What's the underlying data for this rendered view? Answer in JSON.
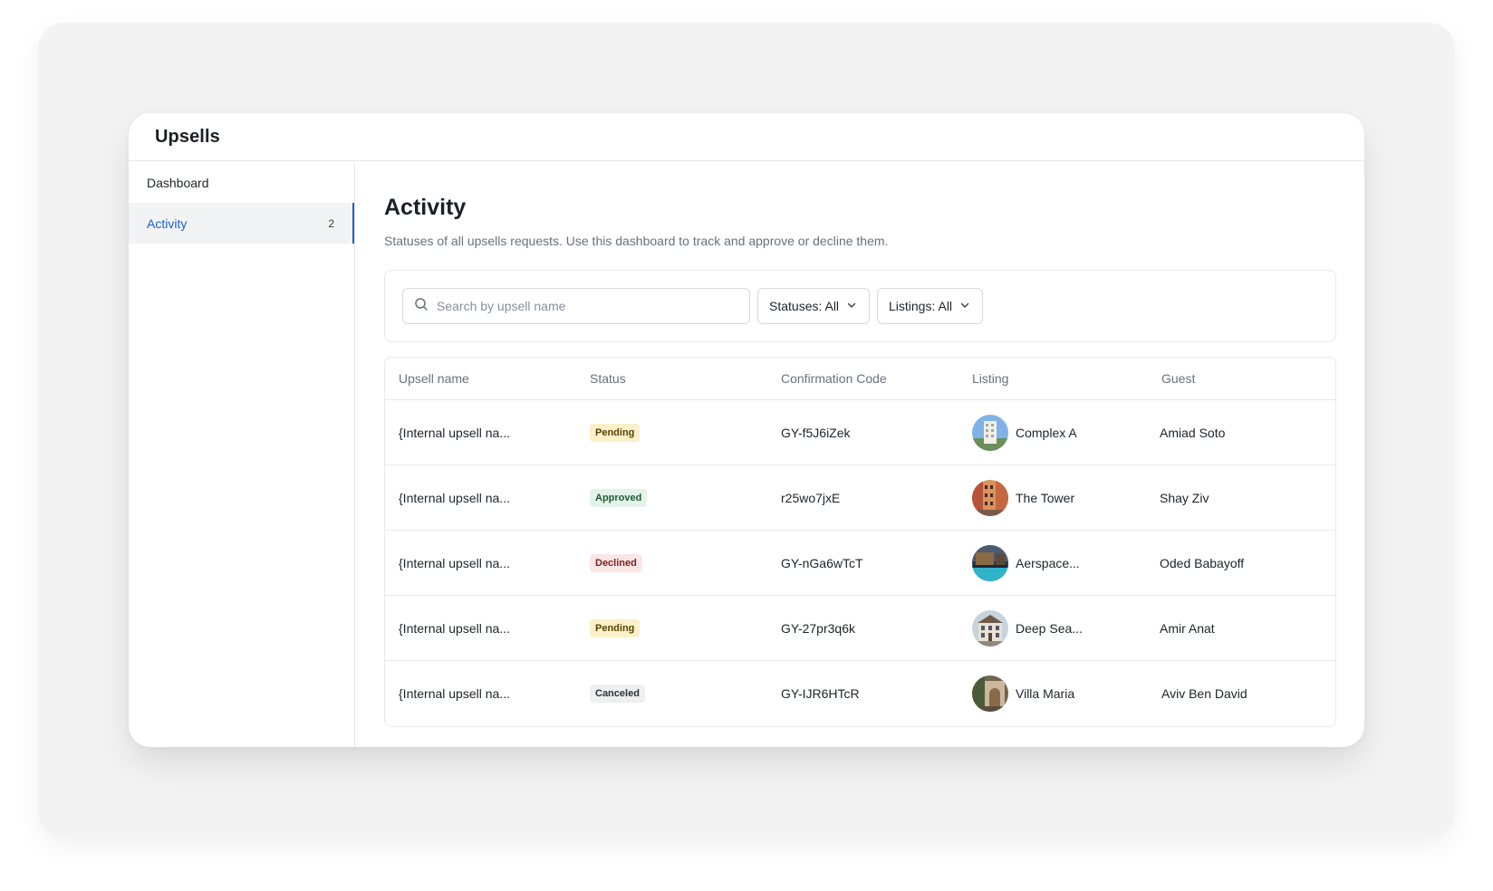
{
  "app": {
    "title": "Upsells"
  },
  "sidebar": {
    "items": [
      {
        "label": "Dashboard",
        "count": ""
      },
      {
        "label": "Activity",
        "count": "2"
      }
    ]
  },
  "page": {
    "title": "Activity",
    "subtitle": "Statuses of all upsells requests. Use this dashboard to track and approve or decline them."
  },
  "filters": {
    "search_placeholder": "Search by upsell name",
    "search_value": "",
    "statuses_label": "Statuses: All",
    "listings_label": "Listings: All"
  },
  "table": {
    "columns": [
      "Upsell name",
      "Status",
      "Confirmation Code",
      "Listing",
      "Guest"
    ],
    "rows": [
      {
        "upsell": "{Internal upsell na...",
        "status": "Pending",
        "code": "GY-f5J6iZek",
        "listing": "Complex A",
        "guest": "Amiad Soto"
      },
      {
        "upsell": "{Internal upsell na...",
        "status": "Approved",
        "code": "r25wo7jxE",
        "listing": "The Tower",
        "guest": "Shay Ziv"
      },
      {
        "upsell": "{Internal upsell na...",
        "status": "Declined",
        "code": "GY-nGa6wTcT",
        "listing": "Aerspace...",
        "guest": "Oded Babayoff"
      },
      {
        "upsell": "{Internal upsell na...",
        "status": "Pending",
        "code": "GY-27pr3q6k",
        "listing": "Deep Sea...",
        "guest": "Amir Anat"
      },
      {
        "upsell": "{Internal upsell na...",
        "status": "Canceled",
        "code": "GY-IJR6HTcR",
        "listing": "Villa Maria",
        "guest": "Aviv Ben David"
      }
    ]
  },
  "colors": {
    "accent": "#1a5fd6",
    "status_pending_bg": "#fbf0c9",
    "status_approved_bg": "#e3f3ea",
    "status_declined_bg": "#fbe6e6",
    "status_canceled_bg": "#efeff1"
  },
  "icons": {
    "search": "search-icon",
    "dropdown": "chevron-down-icon",
    "listing_photo": "listing-photo"
  }
}
